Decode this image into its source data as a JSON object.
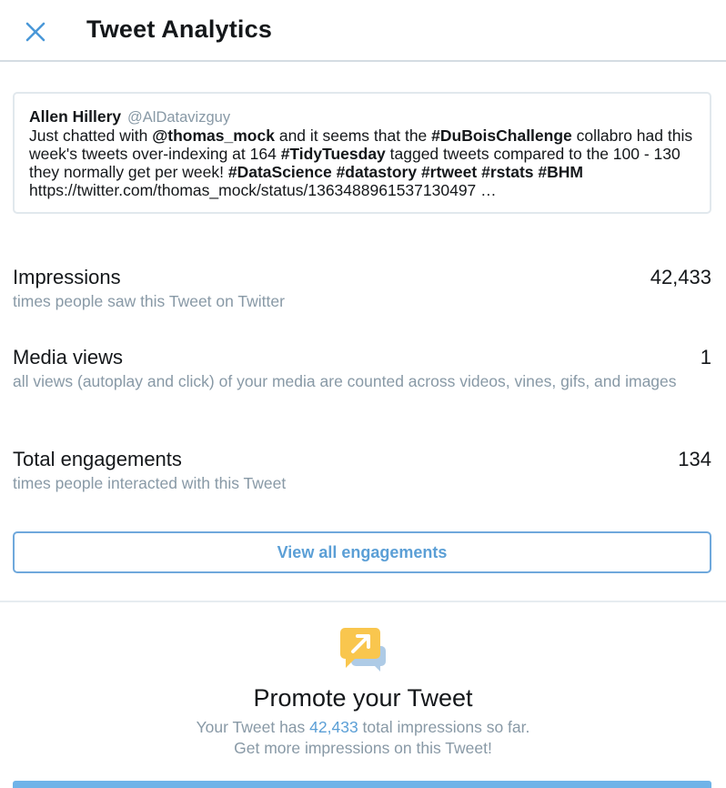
{
  "header": {
    "title": "Tweet Analytics",
    "close_icon": "close-icon"
  },
  "tweet": {
    "author": "Allen Hillery",
    "handle": "@AlDatavizguy",
    "segments": [
      {
        "text": "Just chatted with ",
        "bold": false
      },
      {
        "text": "@thomas_mock",
        "bold": true
      },
      {
        "text": " and it seems that the ",
        "bold": false
      },
      {
        "text": "#DuBoisChallenge",
        "bold": true
      },
      {
        "text": " collabro had this week's tweets over-indexing at 164 ",
        "bold": false
      },
      {
        "text": "#TidyTuesday",
        "bold": true
      },
      {
        "text": " tagged tweets compared to the 100 - 130 they normally get per week! ",
        "bold": false
      },
      {
        "text": "#DataScience",
        "bold": true
      },
      {
        "text": " ",
        "bold": false
      },
      {
        "text": "#datastory",
        "bold": true
      },
      {
        "text": " ",
        "bold": false
      },
      {
        "text": "#rtweet",
        "bold": true
      },
      {
        "text": " ",
        "bold": false
      },
      {
        "text": "#rstats",
        "bold": true
      },
      {
        "text": " ",
        "bold": false
      },
      {
        "text": "#BHM",
        "bold": true
      },
      {
        "text": " https://twitter.com/thomas_mock/status/1363488961537130497 …",
        "bold": false
      }
    ]
  },
  "metrics": {
    "impressions": {
      "label": "Impressions",
      "value": "42,433",
      "description": "times people saw this Tweet on Twitter"
    },
    "media_views": {
      "label": "Media views",
      "value": "1",
      "description": "all views (autoplay and click) of your media are counted across videos, vines, gifs, and images"
    },
    "engagements": {
      "label": "Total engagements",
      "value": "134",
      "description": "times people interacted with this Tweet"
    }
  },
  "view_all_button": "View all engagements",
  "promote": {
    "icon": "promote-icon",
    "title": "Promote your Tweet",
    "line1_prefix": "Your Tweet has ",
    "line1_value": "42,433",
    "line1_suffix": " total impressions so far.",
    "line2": "Get more impressions on this Tweet!"
  },
  "colors": {
    "accent": "#5b9fd6",
    "muted": "#8899a6",
    "promo_icon": "#f9c64e"
  }
}
